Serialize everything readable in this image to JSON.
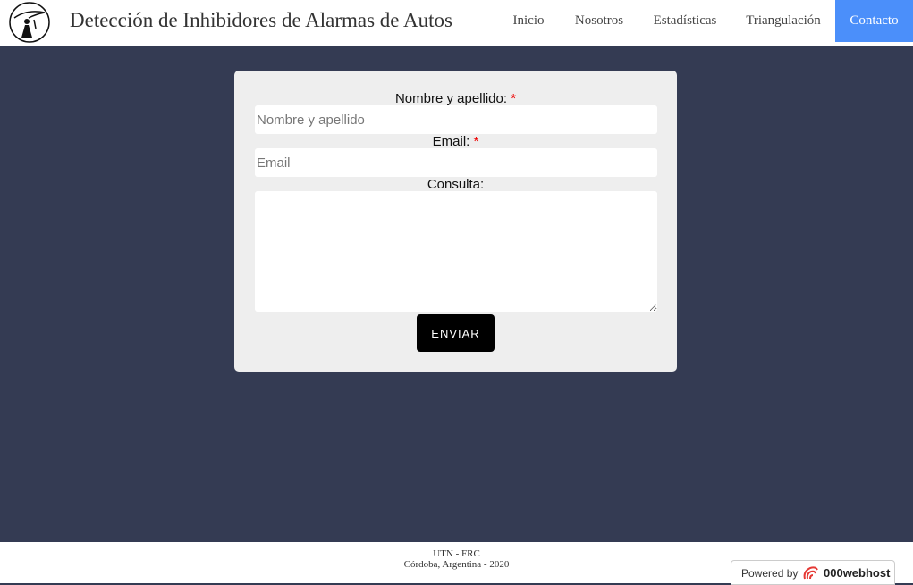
{
  "header": {
    "site_title": "Detección de Inhibidores de Alarmas de Autos",
    "logo_icon": "alarm-logo-icon",
    "nav": [
      {
        "label": "Inicio",
        "active": false
      },
      {
        "label": "Nosotros",
        "active": false
      },
      {
        "label": "Estadísticas",
        "active": false
      },
      {
        "label": "Triangulación",
        "active": false
      },
      {
        "label": "Contacto",
        "active": true
      }
    ],
    "active_color": "#4b8ffa"
  },
  "form": {
    "name_label": "Nombre y apellido:",
    "name_required": "*",
    "name_placeholder": "Nombre y apellido",
    "name_value": "",
    "email_label": "Email:",
    "email_required": "*",
    "email_placeholder": "Email",
    "email_value": "",
    "message_label": "Consulta:",
    "message_value": "",
    "submit_label": "ENVIAR"
  },
  "footer": {
    "line1": "UTN - FRC",
    "line2": "Córdoba, Argentina - 2020"
  },
  "host_badge": {
    "powered_by": "Powered by",
    "brand": "000webhost",
    "logo_icon": "webhost-logo-icon"
  },
  "colors": {
    "background": "#343b53",
    "card": "#eeeeee",
    "required": "#ee0000",
    "button": "#000000"
  }
}
